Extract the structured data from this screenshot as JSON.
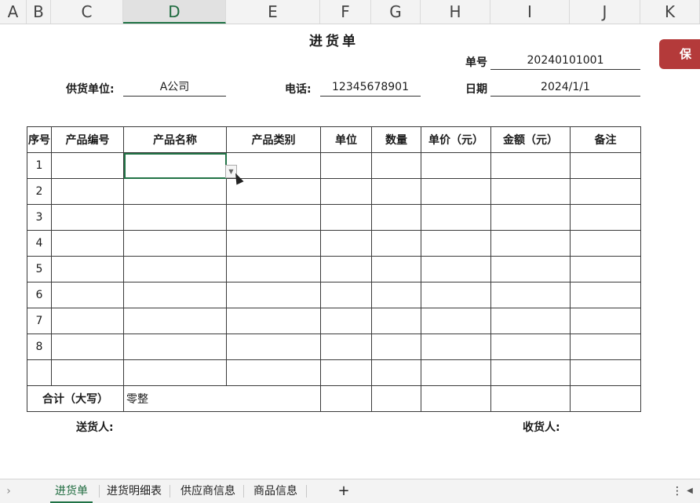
{
  "columns": [
    "A",
    "B",
    "C",
    "D",
    "E",
    "F",
    "G",
    "H",
    "I",
    "J",
    "K"
  ],
  "sheet": {
    "title": "进货单",
    "order_no_label": "单号",
    "order_no": "20240101001",
    "supplier_label": "供货单位:",
    "supplier": "A公司",
    "phone_label": "电话:",
    "phone": "12345678901",
    "date_label": "日期",
    "date": "2024/1/1"
  },
  "table": {
    "headers": [
      "序号",
      "产品编号",
      "产品名称",
      "产品类别",
      "单位",
      "数量",
      "单价（元）",
      "金额（元）",
      "备注"
    ],
    "row_numbers": [
      "1",
      "2",
      "3",
      "4",
      "5",
      "6",
      "7",
      "8",
      ""
    ],
    "total_label": "合计（大写）",
    "total_value": "零整"
  },
  "footer": {
    "deliverer_label": "送货人:",
    "receiver_label": "收货人:"
  },
  "save_button": "保",
  "tabs": [
    "进货单",
    "进货明细表",
    "供应商信息",
    "商品信息"
  ],
  "add_sheet": "+",
  "nav_prev": "›",
  "more_menu": "⋮",
  "scroll_left": "◀"
}
